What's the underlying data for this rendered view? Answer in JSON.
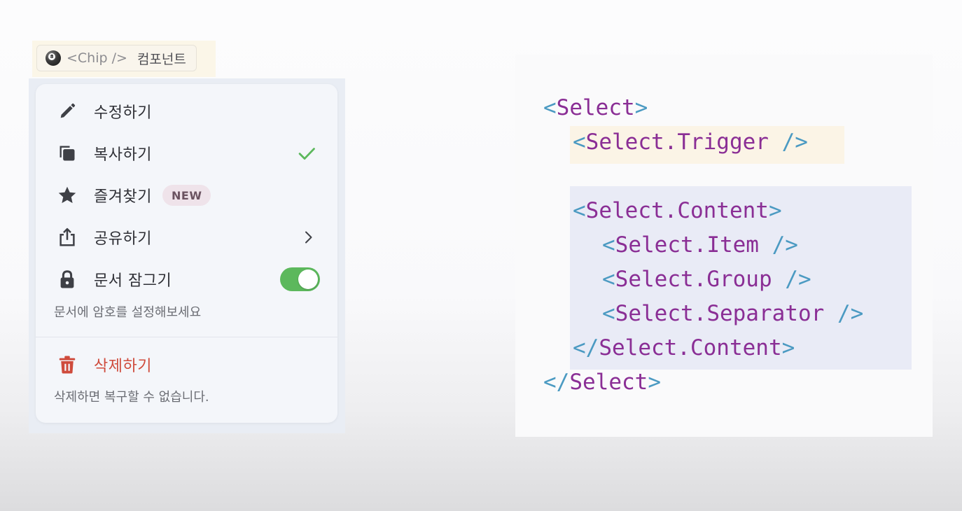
{
  "chip": {
    "icon": "8-ball-icon",
    "code_text": "<Chip />",
    "label": "컴포넌트"
  },
  "menu": {
    "items": [
      {
        "icon": "pencil-icon",
        "label": "수정하기"
      },
      {
        "icon": "copy-icon",
        "label": "복사하기",
        "trailing": "check-icon"
      },
      {
        "icon": "star-icon",
        "label": "즐겨찾기",
        "badge": "NEW"
      },
      {
        "icon": "share-icon",
        "label": "공유하기",
        "trailing": "chevron-right-icon"
      },
      {
        "icon": "lock-icon",
        "label": "문서 잠그기",
        "toggle_on": true,
        "description": "문서에 암호를 설정해보세요"
      }
    ],
    "danger_item": {
      "icon": "trash-icon",
      "label": "삭제하기",
      "description": "삭제하면 복구할 수 없습니다."
    }
  },
  "code": {
    "lines": [
      {
        "open": "<",
        "tag": "Select",
        "close": ">"
      },
      {
        "open": "<",
        "tag": "Select.Trigger",
        "close": " />"
      },
      {
        "open": "<",
        "tag": "Select.Content",
        "close": ">"
      },
      {
        "open": "<",
        "tag": "Select.Item",
        "close": " />"
      },
      {
        "open": "<",
        "tag": "Select.Group",
        "close": " />"
      },
      {
        "open": "<",
        "tag": "Select.Separator",
        "close": " />"
      },
      {
        "open": "</",
        "tag": "Select.Content",
        "close": ">"
      },
      {
        "open": "</",
        "tag": "Select",
        "close": ">"
      }
    ]
  },
  "colors": {
    "accent_green": "#5cb85c",
    "danger": "#cf4b3c",
    "code_tag": "#8a2e95",
    "code_punct": "#4b9ac2",
    "trigger_highlight": "#fbf4e6",
    "content_highlight": "#e9ebf6"
  }
}
